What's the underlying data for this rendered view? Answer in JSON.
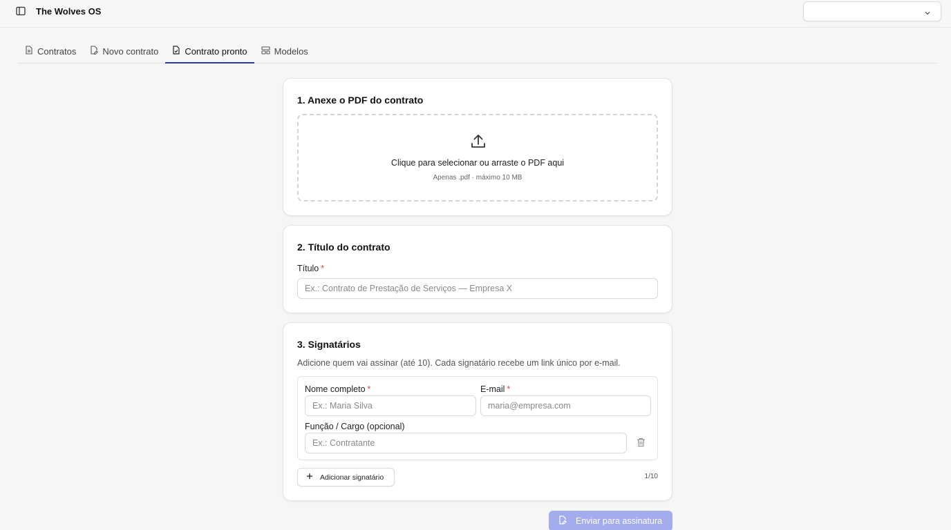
{
  "app": {
    "title": "The Wolves OS"
  },
  "header": {
    "org_select_value": ""
  },
  "tabs": [
    {
      "label": "Contratos",
      "icon": "file-text-icon"
    },
    {
      "label": "Novo contrato",
      "icon": "file-edit-icon"
    },
    {
      "label": "Contrato pronto",
      "icon": "file-check-icon",
      "active": true
    },
    {
      "label": "Modelos",
      "icon": "layout-template-icon"
    }
  ],
  "step1": {
    "title": "1. Anexe o PDF do contrato",
    "drop_main": "Clique para selecionar ou arraste o PDF aqui",
    "drop_sub": "Apenas .pdf · máximo 10 MB"
  },
  "step2": {
    "title": "2. Título do contrato",
    "field_label": "Título",
    "required_mark": "*",
    "placeholder": "Ex.: Contrato de Prestação de Serviços — Empresa X"
  },
  "step3": {
    "title": "3. Signatários",
    "description": "Adicione quem vai assinar (até 10). Cada signatário recebe um link único por e-mail.",
    "name_label": "Nome completo",
    "name_placeholder": "Ex.: Maria Silva",
    "email_label": "E-mail",
    "email_placeholder": "maria@empresa.com",
    "role_label": "Função / Cargo (opcional)",
    "role_placeholder": "Ex.: Contratante",
    "required_mark": "*",
    "add_button": "Adicionar signatário",
    "counter": "1/10"
  },
  "submit": {
    "label": "Enviar para assinatura"
  },
  "colors": {
    "accent": "#2b3a8f",
    "submit_bg": "#a3acec",
    "required": "#d94848"
  }
}
